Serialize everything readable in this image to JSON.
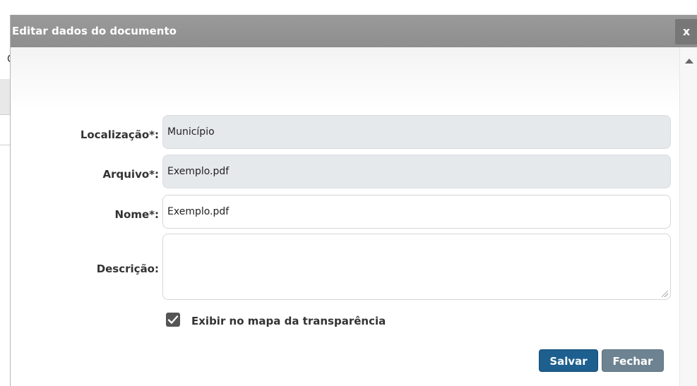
{
  "dialog": {
    "title": "Editar dados do documento",
    "close_label": "x"
  },
  "background": {
    "fragment_text": "C"
  },
  "form": {
    "location_label": "Localização*:",
    "location_value": "Município",
    "file_label": "Arquivo*:",
    "file_value": "Exemplo.pdf",
    "name_label": "Nome*:",
    "name_value": "Exemplo.pdf",
    "description_label": "Descrição:",
    "description_value": "",
    "show_on_map_label": "Exibir no mapa da transparência",
    "show_on_map_checked": true
  },
  "actions": {
    "save_label": "Salvar",
    "close_label": "Fechar"
  },
  "icons": {
    "close": "close-icon",
    "scroll_up": "chevron-up-icon",
    "check": "check-icon",
    "resize": "resize-grip-icon"
  },
  "colors": {
    "titlebar": "#8e8e8e",
    "save_button": "#1d5f8f",
    "close_button": "#6d8391",
    "readonly_field": "#e6e9ec",
    "checkbox": "#555555"
  }
}
